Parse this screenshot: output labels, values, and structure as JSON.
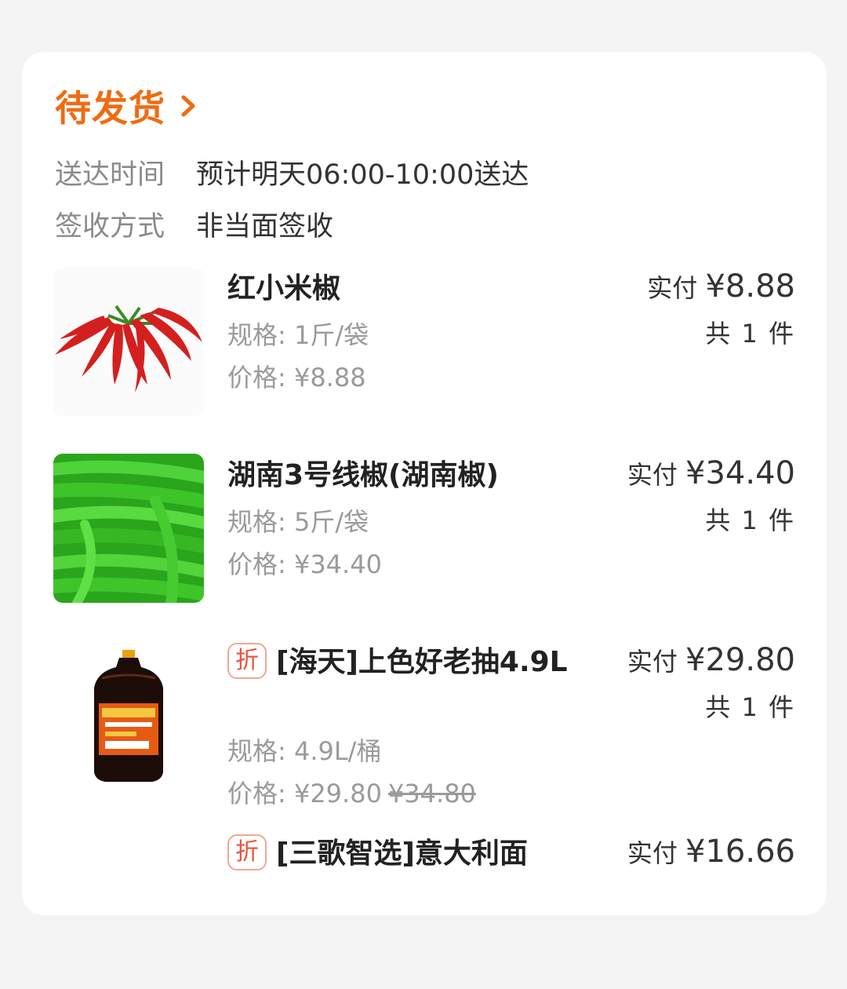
{
  "order": {
    "status": "待发货",
    "delivery_label": "送达时间",
    "delivery_value": "预计明天06:00-10:00送达",
    "receive_label": "签收方式",
    "receive_value": "非当面签收"
  },
  "items": [
    {
      "name": "红小米椒",
      "tag": "",
      "spec": "规格: 1斤/袋",
      "price": "价格: ¥8.88",
      "original_price": "",
      "paid_label": "实付",
      "paid_amount": "¥8.88",
      "count": "共 1 件",
      "image": "red-chili-image"
    },
    {
      "name": "湖南3号线椒(湖南椒)",
      "tag": "",
      "spec": "规格: 5斤/袋",
      "price": "价格: ¥34.40",
      "original_price": "",
      "paid_label": "实付",
      "paid_amount": "¥34.40",
      "count": "共 1 件",
      "image": "green-chili-image"
    },
    {
      "name": "[海天]上色好老抽4.9L",
      "tag": "折",
      "spec": "规格: 4.9L/桶",
      "price": "价格: ¥29.80",
      "original_price": "¥34.80",
      "paid_label": "实付",
      "paid_amount": "¥29.80",
      "count": "共 1 件",
      "image": "soy-sauce-bottle-image"
    },
    {
      "name": "[三歌智选]意大利面",
      "tag": "折",
      "paid_label": "实付",
      "paid_amount": "¥16.66"
    }
  ],
  "colors": {
    "accent": "#f06b12",
    "tag": "#e8553c"
  }
}
